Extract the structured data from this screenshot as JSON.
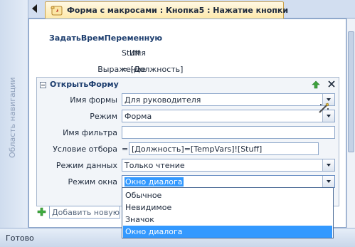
{
  "navigation_pane": {
    "label": "Область навигации"
  },
  "tab": {
    "title": "Форма с макросами : Кнопка5 : Нажатие кнопки",
    "icon": "macro-scroll-icon"
  },
  "set_temp_var": {
    "action_name": "ЗадатьВремПеременную",
    "name_label": "Имя",
    "name_value": "Stuff",
    "expression_label": "Выражение",
    "expression_value": "= [Должность]"
  },
  "open_form": {
    "action_name": "ОткрытьФорму",
    "form_name": {
      "label": "Имя формы",
      "value": "Для руководителя"
    },
    "view": {
      "label": "Режим",
      "value": "Форма"
    },
    "filter_name": {
      "label": "Имя фильтра",
      "value": ""
    },
    "where_condition": {
      "label": "Условие отбора",
      "prefix": "=",
      "value": "[Должность]=[TempVars]![Stuff]"
    },
    "data_mode": {
      "label": "Режим данных",
      "value": "Только чтение"
    },
    "window_mode": {
      "label": "Режим окна",
      "value": "Окно диалога",
      "options": [
        "Обычное",
        "Невидимое",
        "Значок",
        "Окно диалога"
      ],
      "selected_index": 3
    }
  },
  "add_action": {
    "placeholder": "Добавить новую м"
  },
  "status_bar": {
    "text": "Готово"
  },
  "colors": {
    "selection": "#3399ff",
    "title_text": "#1c3d6e",
    "tab_highlight": "#fde8a8"
  }
}
